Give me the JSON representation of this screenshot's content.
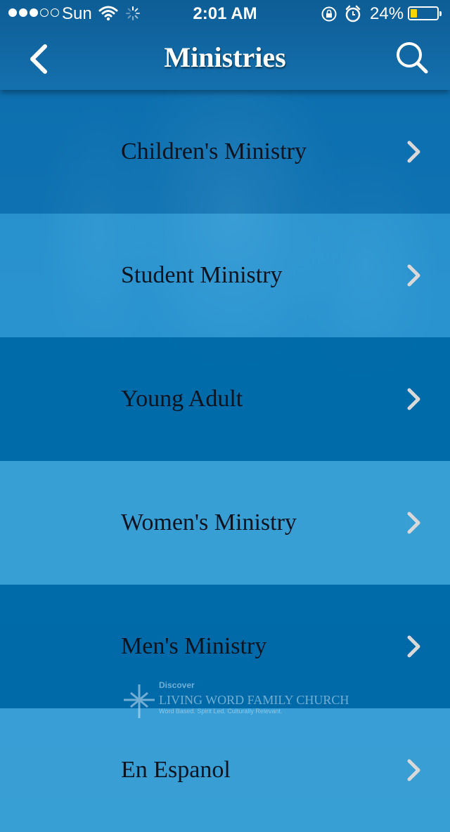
{
  "status_bar": {
    "carrier": "Sun",
    "time": "2:01 AM",
    "battery_percent_label": "24%",
    "battery_level": 0.24,
    "signal_bars_filled": 3,
    "signal_bars_total": 5
  },
  "nav": {
    "title": "Ministries",
    "back_icon": "chevron-left-icon",
    "search_icon": "search-icon"
  },
  "ministries": [
    {
      "label": "Children's Ministry",
      "color": "#0b6faf"
    },
    {
      "label": "Student Ministry",
      "color": "#2f9bd6"
    },
    {
      "label": "Young Adult",
      "color": "#006aa8"
    },
    {
      "label": "Women's Ministry",
      "color": "#3aa0d6"
    },
    {
      "label": "Men's Ministry",
      "color": "#006aa8"
    },
    {
      "label": "En Espanol",
      "color": "#3aa0d6"
    }
  ],
  "watermark": {
    "line1": "Discover",
    "line2": "LIVING WORD FAMILY CHURCH",
    "line3": "Word Based. Spirit Led. Culturally Relevant."
  }
}
